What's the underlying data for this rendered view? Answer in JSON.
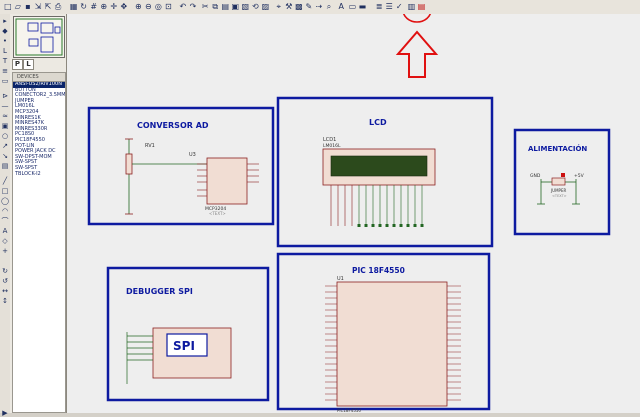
{
  "toolbar": {
    "icons": [
      "new",
      "open",
      "save",
      "import",
      "export",
      "print",
      "area",
      "refresh",
      "grid",
      "origin",
      "cursor",
      "pan",
      "zoom-in",
      "zoom-out",
      "zoom-all",
      "zoom-area",
      "undo",
      "redo",
      "cut",
      "copy",
      "paste",
      "block-copy",
      "block-move",
      "block-rotate",
      "block-delete",
      "pick",
      "make-device",
      "packaging",
      "decompose",
      "wire-autoroute",
      "search",
      "property-assign",
      "new-sheet",
      "remove-sheet",
      "bom",
      "netlist",
      "electrical-check",
      "netlist-ares",
      "highlighted"
    ]
  },
  "panel": {
    "tab_p": "P",
    "tab_l": "L",
    "tab_label": "DEVICES",
    "devices": [
      "ANSI-US2/RIV100N",
      "BUTTON",
      "CONECTOR2_3.5MM",
      "JUMPER",
      "LM016L",
      "MCP3204",
      "MINRES1K",
      "MINRES47K",
      "MINRES330R",
      "PC18S0",
      "PIC18F4550",
      "POT-LIN",
      "POWER JACK DC",
      "SW-DPST-MOM",
      "SW-SPST",
      "SW-SPST",
      "TBLOCK-I2"
    ],
    "selected_index": 0
  },
  "schematic": {
    "conversor": {
      "title": "CONVERSOR AD",
      "rv": "RV1",
      "u": "U3",
      "part": "MCP3204",
      "text": "<TEXT>"
    },
    "lcd": {
      "title": "LCD",
      "ref": "LCD1",
      "part": "LM016L"
    },
    "alimentacion": {
      "title": "ALIMENTACIÓN",
      "gnd": "GND",
      "vcc": "+5V",
      "jumper": "JUMPER",
      "jtext": "<TEXT>"
    },
    "debugger": {
      "title": "DEBUGGER SPI",
      "spi": "SPI"
    },
    "pic": {
      "title": "PIC 18F4550",
      "ref": "U1",
      "part": "PIC18F4550"
    }
  },
  "colors": {
    "box_border": "#0d1aa0",
    "component_fill": "#f1ddd3",
    "component_stroke": "#8c2020",
    "lcd_screen": "#2c4a1c",
    "arrow": "#e01010",
    "wire": "#226622"
  }
}
